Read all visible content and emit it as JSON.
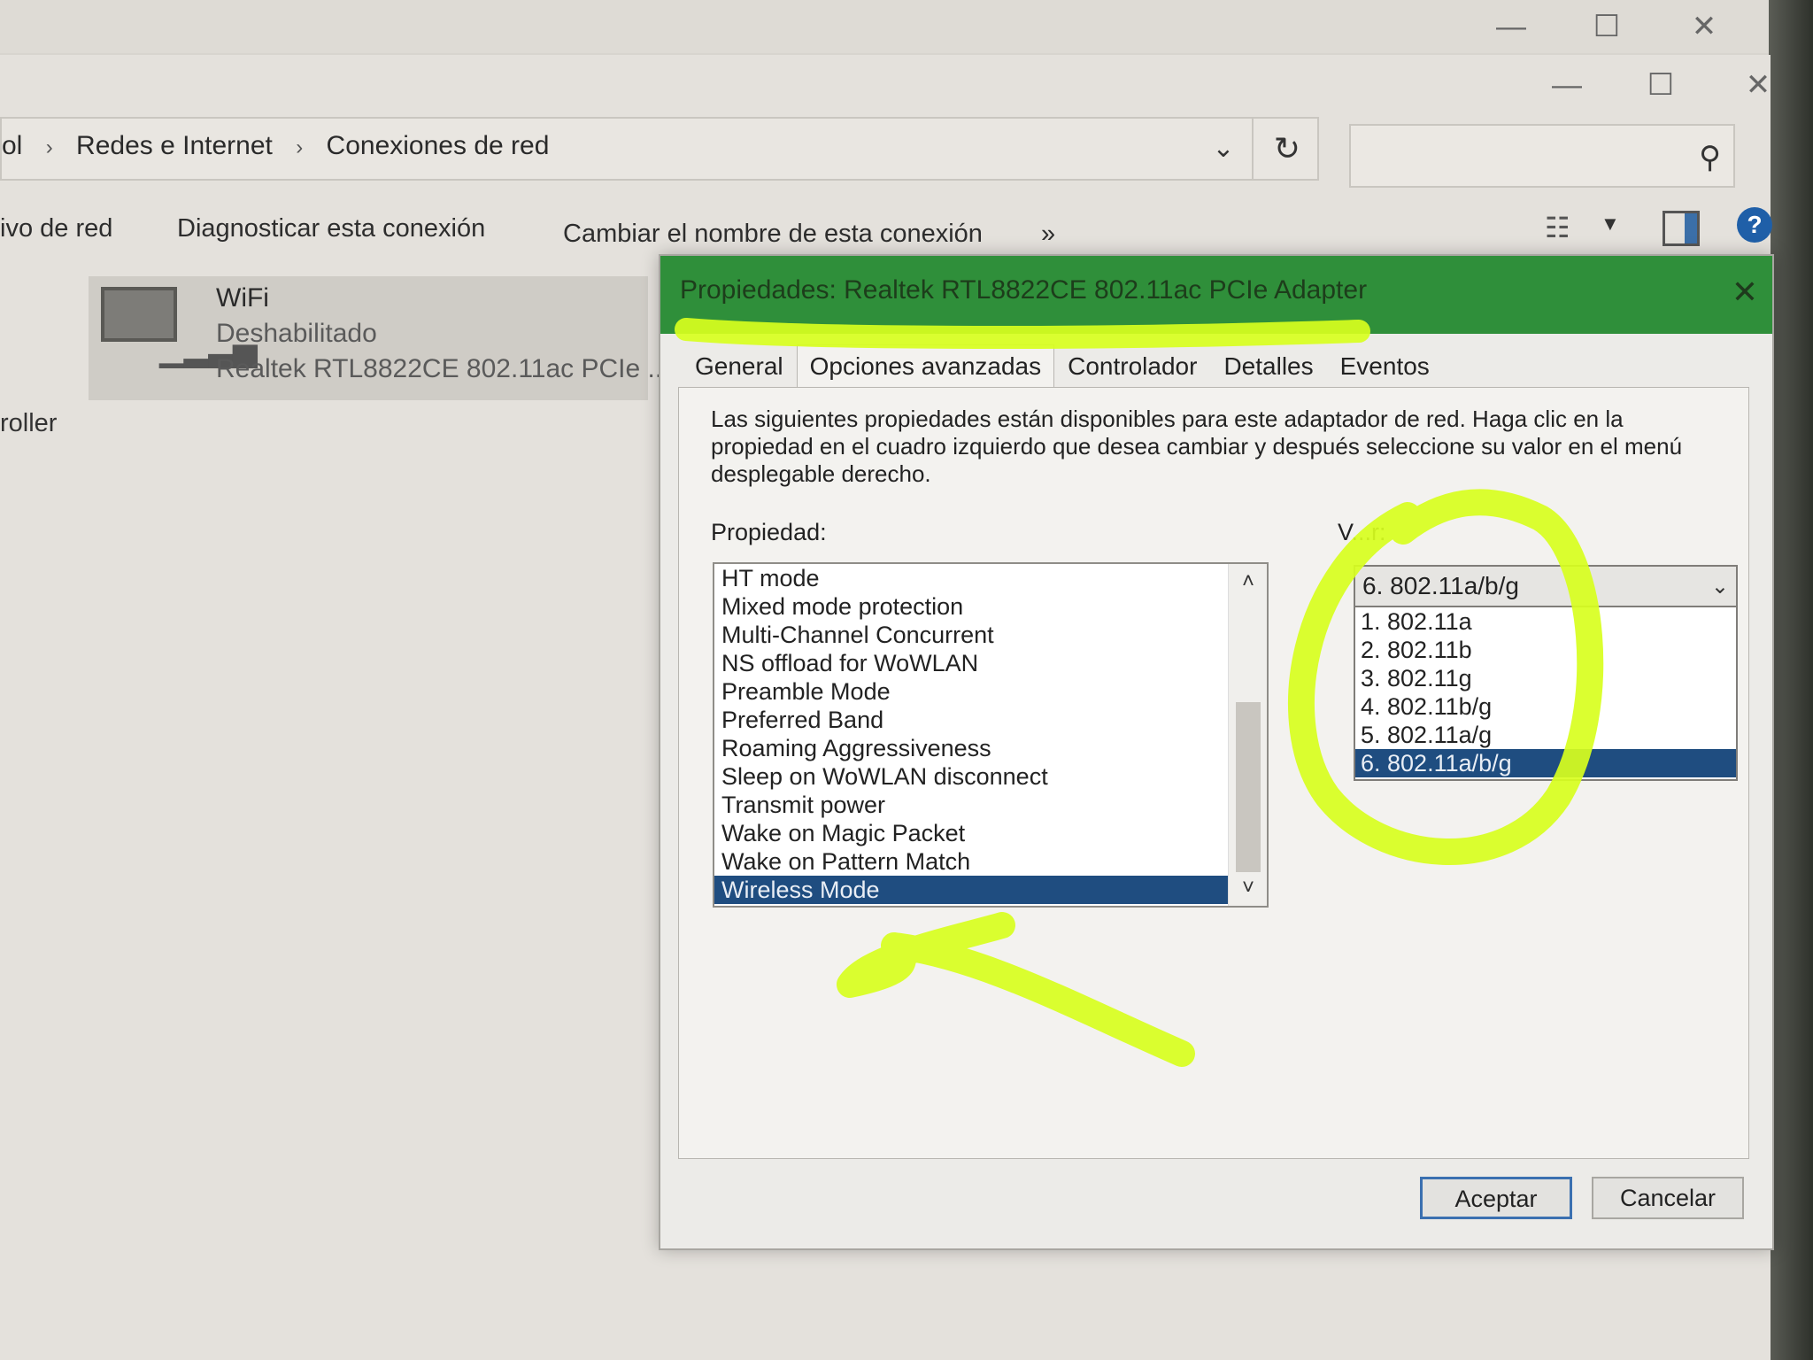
{
  "outer_window": {
    "minimize": "—",
    "maximize": "☐",
    "close": "✕"
  },
  "explorer": {
    "window_controls": {
      "minimize": "—",
      "maximize": "☐",
      "close": "✕"
    },
    "breadcrumb": {
      "partial": "ol",
      "sep": "›",
      "items": [
        "Redes e Internet",
        "Conexiones de red"
      ]
    },
    "address_dropdown": "⌄",
    "refresh_icon": "↻",
    "search_icon": "⚲",
    "commands": [
      "ivo de red",
      "Diagnosticar esta conexión",
      "Cambiar el nombre de esta conexión",
      "»"
    ],
    "help_label": "?",
    "left_partial_text": "roller",
    "connection": {
      "name": "WiFi",
      "status": "Deshabilitado",
      "device": "Realtek RTL8822CE 802.11ac PCIe ..."
    }
  },
  "dialog": {
    "title": "Propiedades: Realtek RTL8822CE 802.11ac PCIe Adapter",
    "close": "✕",
    "tabs": [
      "General",
      "Opciones avanzadas",
      "Controlador",
      "Detalles",
      "Eventos"
    ],
    "active_tab": "Opciones avanzadas",
    "description": "Las siguientes propiedades están disponibles para este adaptador de red. Haga clic en la propiedad en el cuadro izquierdo que desea cambiar y después seleccione su valor en el menú desplegable derecho.",
    "property_label": "Propiedad:",
    "value_label": "V...r:",
    "properties": [
      "HT mode",
      "Mixed mode protection",
      "Multi-Channel Concurrent",
      "NS offload for WoWLAN",
      "Preamble Mode",
      "Preferred Band",
      "Roaming Aggressiveness",
      "Sleep on WoWLAN disconnect",
      "Transmit power",
      "Wake on Magic Packet",
      "Wake on Pattern Match",
      "Wireless Mode"
    ],
    "selected_property": "Wireless Mode",
    "scroll_up": "˄",
    "scroll_down": "˅",
    "value_selected": "6. 802.11a/b/g",
    "value_arrow": "⌄",
    "value_options": [
      "1. 802.11a",
      "2. 802.11b",
      "3. 802.11g",
      "4. 802.11b/g",
      "5. 802.11a/g",
      "6. 802.11a/b/g"
    ],
    "ok_button": "Aceptar",
    "cancel_button": "Cancelar"
  },
  "colors": {
    "dialog_title_bar": "#2f8f3a",
    "selection": "#1f4d80",
    "highlighter": "#d8ff1e",
    "help_icon": "#1f5fa8"
  }
}
